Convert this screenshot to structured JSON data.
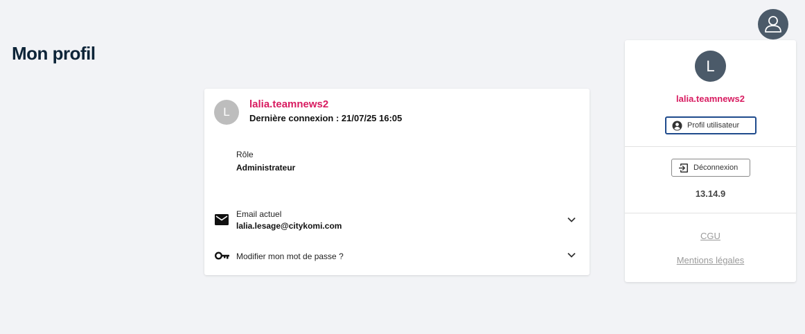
{
  "page": {
    "title": "Mon profil"
  },
  "header": {
    "avatar_icon": "user-outline-icon"
  },
  "profile_card": {
    "avatar_initial": "L",
    "username": "lalia.teamnews2",
    "last_login": "Dernière connexion : 21/07/25 16:05",
    "role_label": "Rôle",
    "role_value": "Administrateur",
    "email_label": "Email actuel",
    "email_value": "lalia.lesage@citykomi.com",
    "password_label": "Modifier mon mot de passe ?"
  },
  "side_panel": {
    "avatar_initial": "L",
    "username": "lalia.teamnews2",
    "profile_button": "Profil utilisateur",
    "logout_button": "Déconnexion",
    "version": "13.14.9",
    "cgu_link": "CGU",
    "legal_link": "Mentions légales"
  },
  "colors": {
    "accent": "#d81b60",
    "title": "#0d2438",
    "avatar_dark": "#4b5a69",
    "button_border": "#1e4a8c",
    "background": "#f2f3f6"
  }
}
